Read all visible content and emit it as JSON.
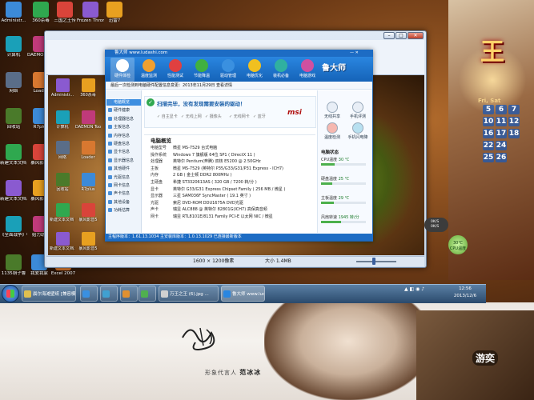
{
  "backdrop": {
    "game_title": "王",
    "ad_spokes_label": "形象代言人",
    "ad_spokes_name": "范冰冰",
    "brand_logo": "游奕"
  },
  "desktop_icons": [
    "Administr...",
    "360杀毒",
    "三国之王传",
    "Frozen Throne",
    "迅雷7",
    "计算机",
    "DAEMON Tools Lite",
    "网络",
    "Loader",
    "回收站",
    "R7plus",
    "新建文本文档 (2).txt",
    "暴风影音5",
    "新建文本文档.txt",
    "暴风影音5",
    "《全面战争》中文版",
    "给力助手",
    "新建文本文档",
    "Excel 2007",
    "1135胡子鲁",
    "我爱我家"
  ],
  "viewer": {
    "status_size": "1600 × 1200像素",
    "status_file": "大小 1.4MB",
    "inner_icons": [
      "Administr...",
      "360杀毒",
      "计算机",
      "DAEMON Tools Lite",
      "网络",
      "Loader",
      "回收站",
      "R7plus",
      "新建文本文档 (2).txt",
      "暴风影音5",
      "新建文本文档.txt",
      "暴风影音5",
      "Excel 2007",
      "Skype"
    ],
    "sidebar_label": "鲁大师 www.ludashi..."
  },
  "calendar": {
    "weekdays": "Fri, Sat",
    "days": [
      "5",
      "6",
      "7",
      "10",
      "11",
      "12",
      "16",
      "17",
      "18",
      "19",
      "22",
      "24",
      "25",
      "26"
    ]
  },
  "ludashi": {
    "title": "鲁大师 www.ludashi.com",
    "logo": "鲁大师",
    "window_ctrls": "— ✕",
    "tabs": [
      "硬件体检",
      "温度监测",
      "性能测试",
      "节能降温",
      "驱动管理",
      "电脑优化",
      "装机必备",
      "电脑游戏"
    ],
    "notice": "最后一次检测到电脑硬件配置信息变更：2013年11月29日   查看详情",
    "sidebar": [
      "电脑概览",
      "硬件健康",
      "处理器信息",
      "主板信息",
      "内存信息",
      "硬盘信息",
      "显卡信息",
      "显示器信息",
      "其他硬件",
      "光驱信息",
      "网卡信息",
      "声卡信息",
      "其他设备",
      "功耗估算"
    ],
    "banner_text": "扫描完毕，没有发现需要安装的驱动！",
    "brand": "msi",
    "checks": [
      "自主显卡",
      "无线上网",
      "摄像头",
      "无线网卡",
      "蓝牙"
    ],
    "section_title": "电脑概览",
    "info": [
      {
        "k": "电脑型号",
        "v": "微星 MS-7529 台式电脑"
      },
      {
        "k": "操作系统",
        "v": "Windows 7 旗舰版 64位 SP1 ( DirectX 11 )"
      },
      {
        "k": "处理器",
        "v": "英特尔 Pentium(奔腾) 双核 E5200 @ 2.50GHz"
      },
      {
        "k": "主板",
        "v": "微星 MS-7529 (英特尔 P35/G33/G31/P31 Express - ICH7)"
      },
      {
        "k": "内存",
        "v": "2 GB ( 金士顿 DDR2 800MHz )"
      },
      {
        "k": "主硬盘",
        "v": "希捷 ST3320613AS ( 320 GB / 7200 转/分 )"
      },
      {
        "k": "显卡",
        "v": "英特尔 G33/G31 Express Chipset Family ( 256 MB / 微星 )"
      },
      {
        "k": "显示器",
        "v": "三星 SAM036F SyncMaster ( 19.1 英寸 )"
      },
      {
        "k": "光驱",
        "v": "索尼 DVD-ROM DDU1675A DVD光驱"
      },
      {
        "k": "声卡",
        "v": "瑞昱 ALC888 @ 英特尔 82801G(ICH7) 高保真音频"
      },
      {
        "k": "网卡",
        "v": "瑞昱 RTL8101E/8131 Family PCI-E 以太网 NIC / 微星"
      }
    ],
    "tools": [
      "无线共享",
      "手机评测",
      "温度检测",
      "手机闪电降"
    ],
    "temps_title": "电脑状态",
    "temps": [
      {
        "label": "CPU温度",
        "value": "30 ℃",
        "level": 0.3
      },
      {
        "label": "硬盘温度",
        "value": "25 ℃",
        "level": 0.25
      },
      {
        "label": "主板温度",
        "value": "29 ℃",
        "level": 0.29
      },
      {
        "label": "风扇转速",
        "value": "1945 转/分",
        "level": 0.45
      }
    ],
    "status": "主程序版本：1.61.13.1034   主安装库版本：1.0.13.1029   已连接最新版本"
  },
  "widgets": {
    "speed_up": "0K/S",
    "speed_down": "0K/S",
    "temp_value": "30℃",
    "temp_label": "CPU温度"
  },
  "taskbar": {
    "buttons": [
      "晨尔海滩壁纸 [兼容模式]",
      "",
      "",
      "",
      "",
      "万王之王 (6).jpg ...",
      "鲁大师 www.luda..."
    ],
    "clock_time": "12:56",
    "clock_date": "2013/12/6"
  }
}
